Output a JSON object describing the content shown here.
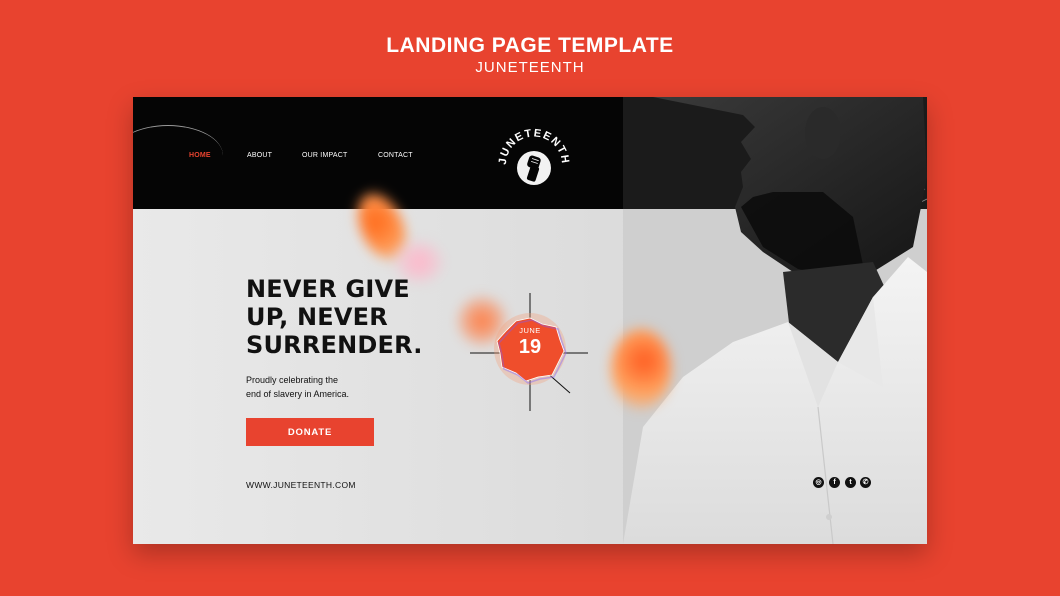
{
  "banner": {
    "title": "LANDING PAGE TEMPLATE",
    "subtitle": "JUNETEENTH"
  },
  "nav": {
    "items": [
      {
        "label": "HOME",
        "active": true
      },
      {
        "label": "ABOUT",
        "active": false
      },
      {
        "label": "OUR IMPACT",
        "active": false
      },
      {
        "label": "CONTACT",
        "active": false
      }
    ]
  },
  "logo": {
    "text": "JUNETEENTH",
    "icon": "raised-fist-icon"
  },
  "hero": {
    "headline": [
      "NEVER GIVE",
      "UP, NEVER",
      "SURRENDER."
    ],
    "subtext": [
      "Proudly celebrating the",
      "end of slavery in America."
    ],
    "donate_label": "DONATE",
    "website": "WWW.JUNETEENTH.COM"
  },
  "badge": {
    "month": "JUNE",
    "day": "19"
  },
  "social": {
    "icons": [
      "instagram-icon",
      "facebook-icon",
      "twitter-icon",
      "whatsapp-icon"
    ],
    "glyphs": [
      "◎",
      "f",
      "t",
      "✆"
    ]
  },
  "colors": {
    "accent": "#e8432f",
    "header": "#050505",
    "background": "#e6e6e6",
    "text": "#111111"
  }
}
